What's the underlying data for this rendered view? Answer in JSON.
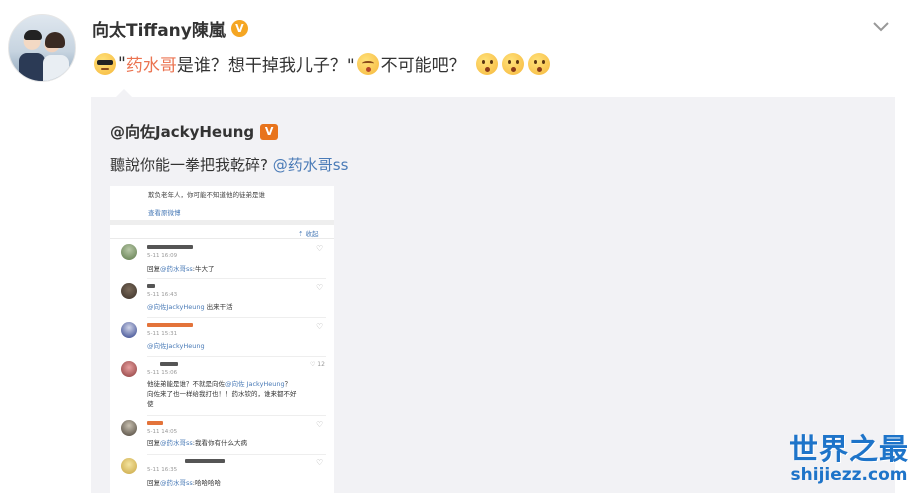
{
  "post": {
    "username": "向太Tiffany陳嵐",
    "verified_badge": "V",
    "text_before": "\"",
    "mention": "药水哥",
    "text_middle": "是谁？想干掉我儿子？\"",
    "text_after": "不可能吧？",
    "emojis": [
      "cool-emoji",
      "blush-emoji",
      "think-emoji",
      "think-emoji",
      "think-emoji"
    ]
  },
  "repost": {
    "username": "@向佐JackyHeung",
    "verified_badge": "V",
    "text": "聽說你能一拳把我乾碎?",
    "mention": "@药水哥ss"
  },
  "screenshot": {
    "top_text": "欺负老年人，你可能不知道他的徒弟是谁",
    "view_original": "查看原微博",
    "collapse": "收起",
    "comments": [
      {
        "time": "5-11 16:09",
        "pre": "回复",
        "mention": "@药水哥ss",
        "post": ":牛大了",
        "likes": ""
      },
      {
        "time": "5-11 16:43",
        "pre": "",
        "mention": "@向佐JackyHeung",
        "post": " 出来干活",
        "likes": ""
      },
      {
        "time": "5-11 15:31",
        "pre": "",
        "mention": "@向佐JackyHeung",
        "post": "",
        "likes": ""
      },
      {
        "time": "5-11 15:06",
        "pre": "他徒弟能是谁？不就是向佐",
        "mention": "@向佐 JackyHeung",
        "post": "？",
        "line2": "向佐来了也一样给我打也！！药水钦的，谁来都不好",
        "line3": "使",
        "likes": "12"
      },
      {
        "time": "5-11 14:05",
        "pre": "回复",
        "mention": "@药水哥ss",
        "post": ":我看你有什么大病",
        "likes": ""
      },
      {
        "time": "5-11 16:35",
        "pre": "回复",
        "mention": "@药水哥ss",
        "post": ":哈哈哈哈",
        "likes": ""
      }
    ]
  },
  "watermark": {
    "cn": "世界之最",
    "en": "shijiezz.com"
  },
  "colors": {
    "link": "#eb7350",
    "quote_bg": "#f2f2f5",
    "watermark": "#1e74c9",
    "mention_blue": "#4a7bb7"
  }
}
